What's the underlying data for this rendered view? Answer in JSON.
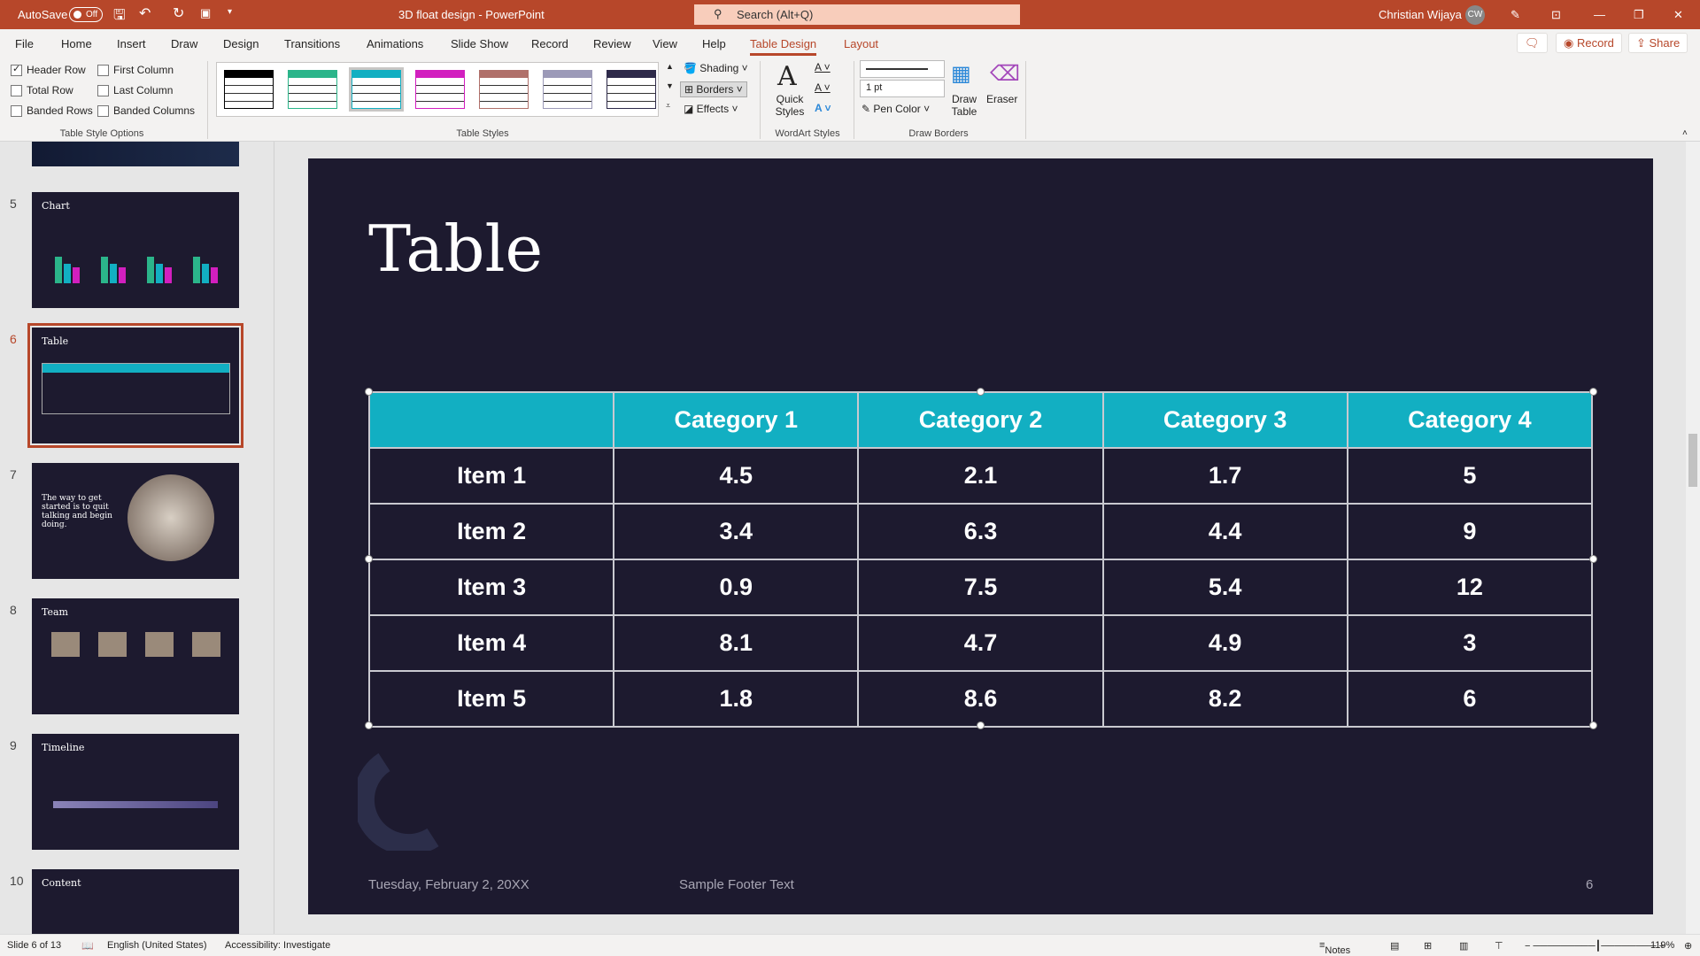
{
  "titlebar": {
    "autosave": "AutoSave",
    "autosave_state": "Off",
    "doc_title": "3D float design  -  PowerPoint",
    "search_placeholder": "Search (Alt+Q)",
    "user": "Christian Wijaya",
    "initials": "CW"
  },
  "menu": {
    "tabs": [
      "File",
      "Home",
      "Insert",
      "Draw",
      "Design",
      "Transitions",
      "Animations",
      "Slide Show",
      "Record",
      "Review",
      "View",
      "Help",
      "Table Design",
      "Layout"
    ],
    "active": "Table Design",
    "record": "Record",
    "share": "Share"
  },
  "ribbon": {
    "options": [
      {
        "label": "Header Row",
        "checked": true
      },
      {
        "label": "First Column",
        "checked": false
      },
      {
        "label": "Total Row",
        "checked": false
      },
      {
        "label": "Last Column",
        "checked": false
      },
      {
        "label": "Banded Rows",
        "checked": false
      },
      {
        "label": "Banded Columns",
        "checked": false
      }
    ],
    "options_group": "Table Style Options",
    "styles_group": "Table Styles",
    "style_colors": [
      "#000000",
      "#2bb58a",
      "#12afc2",
      "#d21fbf",
      "#b0706a",
      "#9c9ab8",
      "#2e2a4a"
    ],
    "shading": "Shading",
    "borders": "Borders",
    "effects": "Effects",
    "quick_styles": "Quick Styles",
    "wordart_group": "WordArt Styles",
    "pen_weight": "1 pt",
    "pen_color": "Pen Color",
    "draw_table": "Draw Table",
    "eraser": "Eraser",
    "draw_group": "Draw Borders"
  },
  "thumbnails": [
    {
      "num": "5",
      "title": "Chart"
    },
    {
      "num": "6",
      "title": "Table",
      "selected": true
    },
    {
      "num": "7",
      "title": "The way to get started is to quit talking and begin doing."
    },
    {
      "num": "8",
      "title": "Team"
    },
    {
      "num": "9",
      "title": "Timeline"
    },
    {
      "num": "10",
      "title": "Content"
    }
  ],
  "slide": {
    "title": "Table",
    "headers": [
      "",
      "Category 1",
      "Category 2",
      "Category 3",
      "Category 4"
    ],
    "rows": [
      [
        "Item 1",
        "4.5",
        "2.1",
        "1.7",
        "5"
      ],
      [
        "Item 2",
        "3.4",
        "6.3",
        "4.4",
        "9"
      ],
      [
        "Item 3",
        "0.9",
        "7.5",
        "5.4",
        "12"
      ],
      [
        "Item 4",
        "8.1",
        "4.7",
        "4.9",
        "3"
      ],
      [
        "Item 5",
        "1.8",
        "8.6",
        "8.2",
        "6"
      ]
    ],
    "header_color": "#12afc2",
    "background": "#1d1a2f",
    "date": "Tuesday, February 2, 20XX",
    "footer": "Sample Footer Text",
    "page": "6"
  },
  "status": {
    "slide": "Slide 6 of 13",
    "language": "English (United States)",
    "accessibility": "Accessibility: Investigate",
    "notes": "Notes",
    "zoom": "119%"
  }
}
